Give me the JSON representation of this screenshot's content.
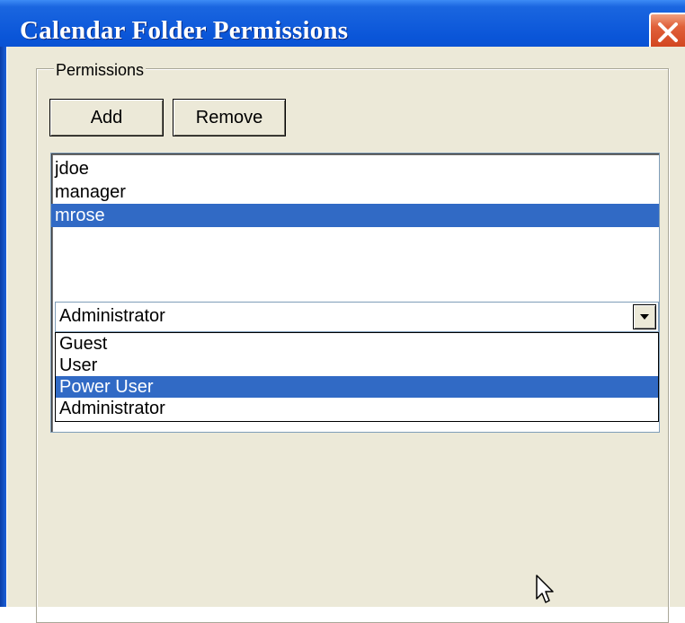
{
  "window": {
    "title": "Calendar Folder Permissions"
  },
  "permissions": {
    "group_label": "Permissions",
    "add_label": "Add",
    "remove_label": "Remove",
    "users": [
      "jdoe",
      "manager",
      "mrose"
    ],
    "selected_user_index": 2
  },
  "role_select": {
    "value": "Administrator",
    "options": [
      "Guest",
      "User",
      "Power User",
      "Administrator"
    ],
    "highlighted_index": 2
  },
  "colors": {
    "title_bar": "#0a55d8",
    "selection": "#316ac5",
    "dialog_bg": "#ece9d8",
    "close_button": "#e0603a"
  },
  "icons": {
    "close": "close-icon",
    "dropdown_arrow": "chevron-down-icon",
    "cursor": "mouse-pointer-icon"
  }
}
